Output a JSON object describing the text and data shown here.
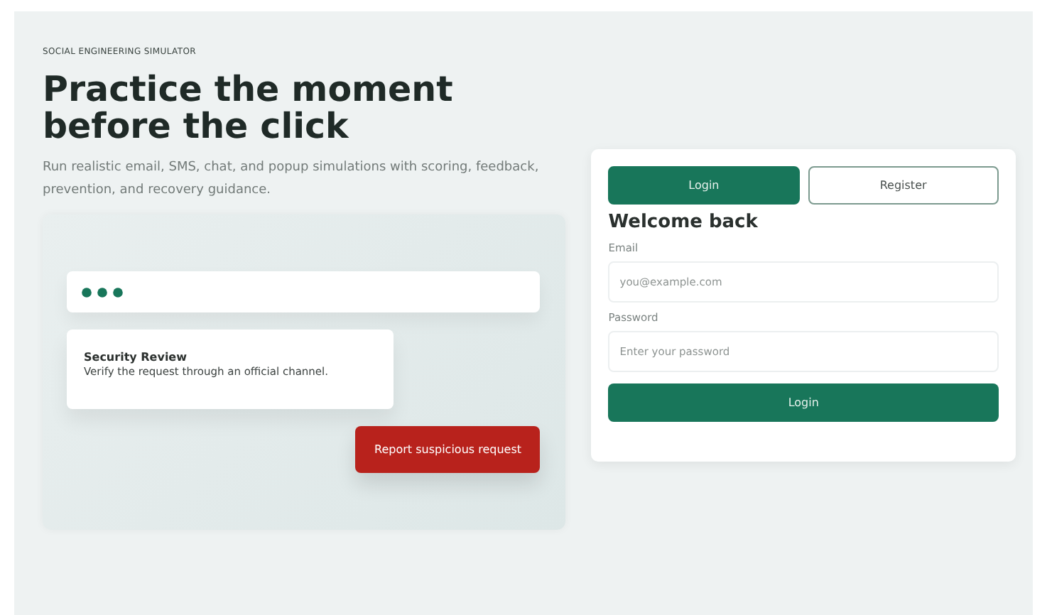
{
  "eyebrow": "SOCIAL ENGINEERING SIMULATOR",
  "headline": "Practice the moment before the click",
  "intro": "Run realistic email, SMS, chat, and popup simulations with scoring, feedback, prevention, and recovery guidance.",
  "preview": {
    "message": {
      "title": "Security Review",
      "body": "Verify the request through an official channel."
    },
    "action": "Report suspicious request"
  },
  "auth": {
    "tabs": [
      {
        "label": "Login",
        "selected": true
      },
      {
        "label": "Register",
        "selected": false
      }
    ],
    "heading": "Welcome back",
    "fields": [
      {
        "label": "Email",
        "placeholder": "you@example.com"
      },
      {
        "label": "Password",
        "placeholder": "Enter your password"
      }
    ],
    "submit": "Login"
  }
}
